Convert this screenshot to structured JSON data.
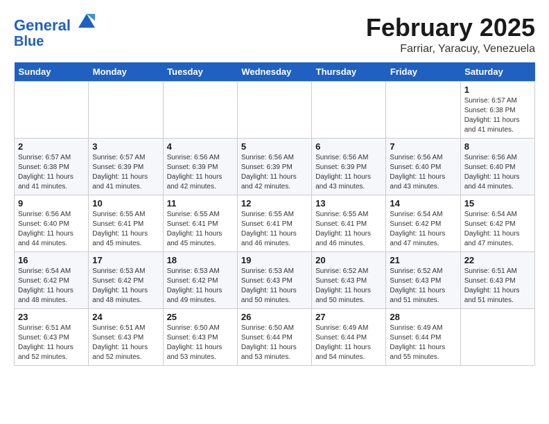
{
  "header": {
    "logo_line1": "General",
    "logo_line2": "Blue",
    "title": "February 2025",
    "subtitle": "Farriar, Yaracuy, Venezuela"
  },
  "weekdays": [
    "Sunday",
    "Monday",
    "Tuesday",
    "Wednesday",
    "Thursday",
    "Friday",
    "Saturday"
  ],
  "weeks": [
    [
      {
        "day": "",
        "info": ""
      },
      {
        "day": "",
        "info": ""
      },
      {
        "day": "",
        "info": ""
      },
      {
        "day": "",
        "info": ""
      },
      {
        "day": "",
        "info": ""
      },
      {
        "day": "",
        "info": ""
      },
      {
        "day": "1",
        "info": "Sunrise: 6:57 AM\nSunset: 6:38 PM\nDaylight: 11 hours\nand 41 minutes."
      }
    ],
    [
      {
        "day": "2",
        "info": "Sunrise: 6:57 AM\nSunset: 6:38 PM\nDaylight: 11 hours\nand 41 minutes."
      },
      {
        "day": "3",
        "info": "Sunrise: 6:57 AM\nSunset: 6:39 PM\nDaylight: 11 hours\nand 41 minutes."
      },
      {
        "day": "4",
        "info": "Sunrise: 6:56 AM\nSunset: 6:39 PM\nDaylight: 11 hours\nand 42 minutes."
      },
      {
        "day": "5",
        "info": "Sunrise: 6:56 AM\nSunset: 6:39 PM\nDaylight: 11 hours\nand 42 minutes."
      },
      {
        "day": "6",
        "info": "Sunrise: 6:56 AM\nSunset: 6:39 PM\nDaylight: 11 hours\nand 43 minutes."
      },
      {
        "day": "7",
        "info": "Sunrise: 6:56 AM\nSunset: 6:40 PM\nDaylight: 11 hours\nand 43 minutes."
      },
      {
        "day": "8",
        "info": "Sunrise: 6:56 AM\nSunset: 6:40 PM\nDaylight: 11 hours\nand 44 minutes."
      }
    ],
    [
      {
        "day": "9",
        "info": "Sunrise: 6:56 AM\nSunset: 6:40 PM\nDaylight: 11 hours\nand 44 minutes."
      },
      {
        "day": "10",
        "info": "Sunrise: 6:55 AM\nSunset: 6:41 PM\nDaylight: 11 hours\nand 45 minutes."
      },
      {
        "day": "11",
        "info": "Sunrise: 6:55 AM\nSunset: 6:41 PM\nDaylight: 11 hours\nand 45 minutes."
      },
      {
        "day": "12",
        "info": "Sunrise: 6:55 AM\nSunset: 6:41 PM\nDaylight: 11 hours\nand 46 minutes."
      },
      {
        "day": "13",
        "info": "Sunrise: 6:55 AM\nSunset: 6:41 PM\nDaylight: 11 hours\nand 46 minutes."
      },
      {
        "day": "14",
        "info": "Sunrise: 6:54 AM\nSunset: 6:42 PM\nDaylight: 11 hours\nand 47 minutes."
      },
      {
        "day": "15",
        "info": "Sunrise: 6:54 AM\nSunset: 6:42 PM\nDaylight: 11 hours\nand 47 minutes."
      }
    ],
    [
      {
        "day": "16",
        "info": "Sunrise: 6:54 AM\nSunset: 6:42 PM\nDaylight: 11 hours\nand 48 minutes."
      },
      {
        "day": "17",
        "info": "Sunrise: 6:53 AM\nSunset: 6:42 PM\nDaylight: 11 hours\nand 48 minutes."
      },
      {
        "day": "18",
        "info": "Sunrise: 6:53 AM\nSunset: 6:42 PM\nDaylight: 11 hours\nand 49 minutes."
      },
      {
        "day": "19",
        "info": "Sunrise: 6:53 AM\nSunset: 6:43 PM\nDaylight: 11 hours\nand 50 minutes."
      },
      {
        "day": "20",
        "info": "Sunrise: 6:52 AM\nSunset: 6:43 PM\nDaylight: 11 hours\nand 50 minutes."
      },
      {
        "day": "21",
        "info": "Sunrise: 6:52 AM\nSunset: 6:43 PM\nDaylight: 11 hours\nand 51 minutes."
      },
      {
        "day": "22",
        "info": "Sunrise: 6:51 AM\nSunset: 6:43 PM\nDaylight: 11 hours\nand 51 minutes."
      }
    ],
    [
      {
        "day": "23",
        "info": "Sunrise: 6:51 AM\nSunset: 6:43 PM\nDaylight: 11 hours\nand 52 minutes."
      },
      {
        "day": "24",
        "info": "Sunrise: 6:51 AM\nSunset: 6:43 PM\nDaylight: 11 hours\nand 52 minutes."
      },
      {
        "day": "25",
        "info": "Sunrise: 6:50 AM\nSunset: 6:43 PM\nDaylight: 11 hours\nand 53 minutes."
      },
      {
        "day": "26",
        "info": "Sunrise: 6:50 AM\nSunset: 6:44 PM\nDaylight: 11 hours\nand 53 minutes."
      },
      {
        "day": "27",
        "info": "Sunrise: 6:49 AM\nSunset: 6:44 PM\nDaylight: 11 hours\nand 54 minutes."
      },
      {
        "day": "28",
        "info": "Sunrise: 6:49 AM\nSunset: 6:44 PM\nDaylight: 11 hours\nand 55 minutes."
      },
      {
        "day": "",
        "info": ""
      }
    ]
  ]
}
